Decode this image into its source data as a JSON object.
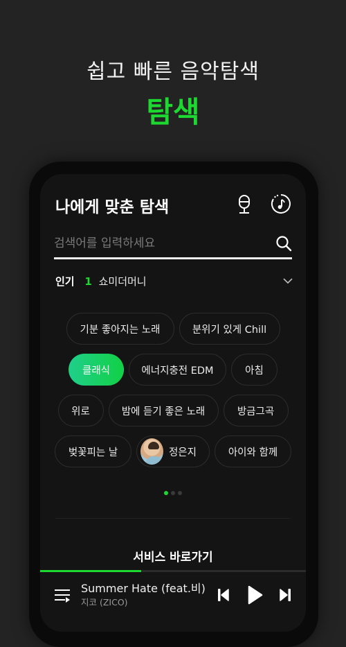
{
  "promo": {
    "subtitle": "쉽고 빠른 음악탐색",
    "title": "탐색"
  },
  "header": {
    "title": "나에게 맞춘 탐색",
    "icons": [
      "mic-icon",
      "music-recognition-icon"
    ]
  },
  "search": {
    "value": "",
    "placeholder": "검색어를 입력하세요"
  },
  "popular": {
    "label": "인기",
    "rank": "1",
    "keyword": "쇼미더머니"
  },
  "chips": {
    "row1": [
      {
        "label": "기분 좋아지는 노래",
        "active": false
      },
      {
        "label": "분위기 있게 Chill",
        "active": false
      }
    ],
    "row2": [
      {
        "label": "클래식",
        "active": true
      },
      {
        "label": "에너지충전 EDM",
        "active": false
      },
      {
        "label": "아침",
        "active": false
      }
    ],
    "row3": [
      {
        "label": "위로",
        "active": false
      },
      {
        "label": "밤에 듣기 좋은 노래",
        "active": false
      },
      {
        "label": "방금그곡",
        "active": false
      }
    ],
    "row4": [
      {
        "label": "벚꽃피는 날",
        "active": false
      },
      {
        "label": "정은지",
        "active": false,
        "has_avatar": true
      },
      {
        "label": "아이와 함께",
        "active": false
      }
    ]
  },
  "pagination": {
    "total": 3,
    "current": 1
  },
  "service": {
    "title": "서비스 바로가기"
  },
  "player": {
    "title": "Summer Hate (feat.비)",
    "artist": "지코 (ZICO)",
    "progress_percent": 38,
    "controls": [
      "previous",
      "play",
      "next"
    ]
  },
  "colors": {
    "accent": "#1ed832",
    "background": "#232323",
    "screen": "#141414"
  }
}
